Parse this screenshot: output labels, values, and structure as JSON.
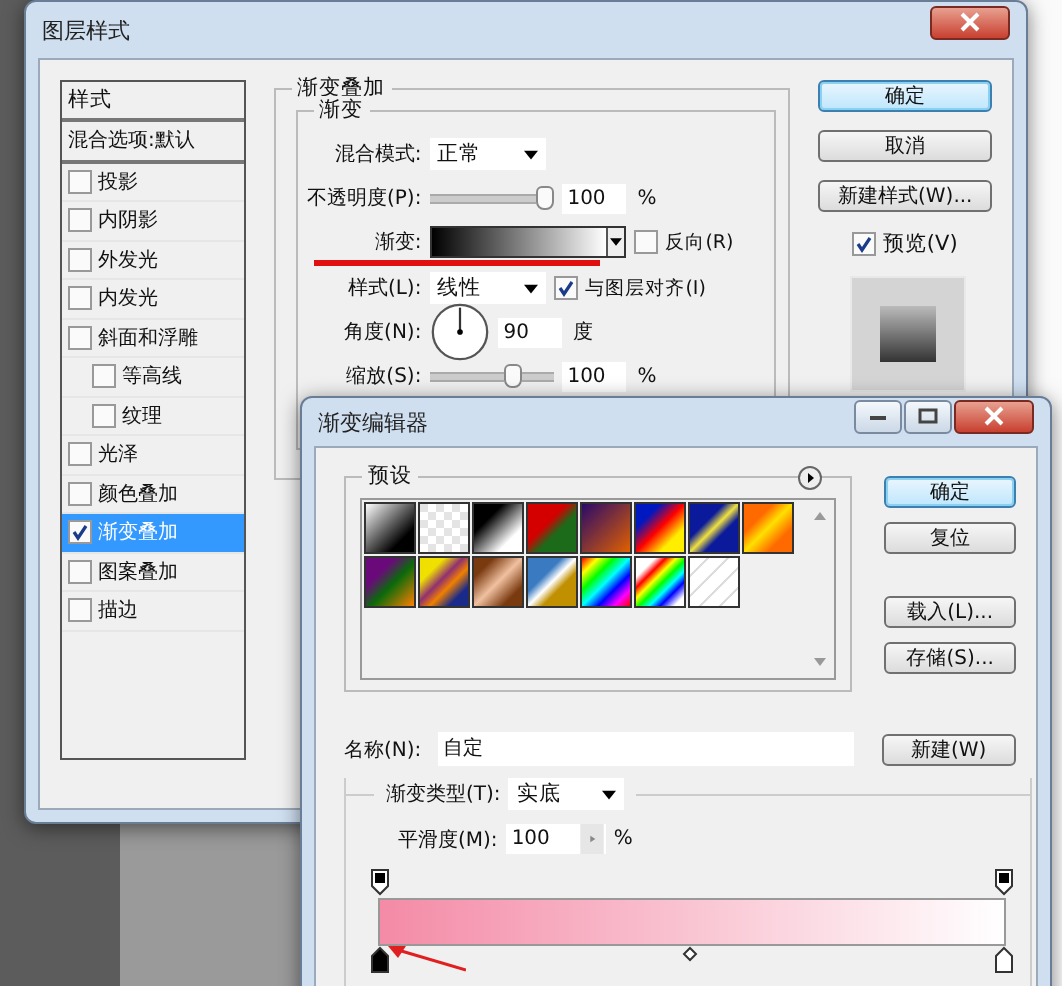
{
  "layer_style": {
    "title": "图层样式",
    "styles_header": "样式",
    "blend_options": "混合选项:默认",
    "effects": [
      {
        "label": "投影",
        "checked": false,
        "selected": false
      },
      {
        "label": "内阴影",
        "checked": false,
        "selected": false
      },
      {
        "label": "外发光",
        "checked": false,
        "selected": false
      },
      {
        "label": "内发光",
        "checked": false,
        "selected": false
      },
      {
        "label": "斜面和浮雕",
        "checked": false,
        "selected": false,
        "children": [
          {
            "label": "等高线",
            "checked": false,
            "selected": false
          },
          {
            "label": "纹理",
            "checked": false,
            "selected": false
          }
        ]
      },
      {
        "label": "光泽",
        "checked": false,
        "selected": false
      },
      {
        "label": "颜色叠加",
        "checked": false,
        "selected": false
      },
      {
        "label": "渐变叠加",
        "checked": true,
        "selected": true
      },
      {
        "label": "图案叠加",
        "checked": false,
        "selected": false
      },
      {
        "label": "描边",
        "checked": false,
        "selected": false
      }
    ],
    "section_title": "渐变叠加",
    "group_title": "渐变",
    "blend_mode": {
      "label": "混合模式:",
      "value": "正常"
    },
    "opacity": {
      "label": "不透明度(P):",
      "level": 1,
      "value": "100",
      "unit": "%"
    },
    "gradient": {
      "label": "渐变:",
      "reverse": {
        "label": "反向(R)",
        "checked": false
      }
    },
    "style": {
      "label": "样式(L):",
      "value": "线性",
      "align": {
        "label": "与图层对齐(I)",
        "checked": true
      }
    },
    "angle": {
      "label": "角度(N):",
      "value": "90",
      "unit": "度"
    },
    "scale": {
      "label": "缩放(S):",
      "level": 0.7,
      "value": "100",
      "unit": "%"
    },
    "buttons": [
      {
        "label": "确定",
        "default": true
      },
      {
        "label": "取消",
        "default": false
      },
      {
        "label": "新建样式(W)...",
        "default": false
      }
    ],
    "preview": {
      "label": "预览(V)",
      "checked": true
    }
  },
  "gradient_editor": {
    "title": "渐变编辑器",
    "presets_label": "预设",
    "buttons": [
      {
        "label": "确定",
        "default": true
      },
      {
        "label": "复位",
        "default": false
      },
      {
        "label": "载入(L)...",
        "default": false
      },
      {
        "label": "存储(S)...",
        "default": false
      }
    ],
    "name": {
      "label": "名称(N):",
      "value": "自定"
    },
    "new_button": "新建(W)",
    "gradient_type": {
      "label": "渐变类型(T):",
      "value": "实底"
    },
    "smoothness": {
      "label": "平滑度(M):",
      "value": "100",
      "unit": "%"
    }
  }
}
